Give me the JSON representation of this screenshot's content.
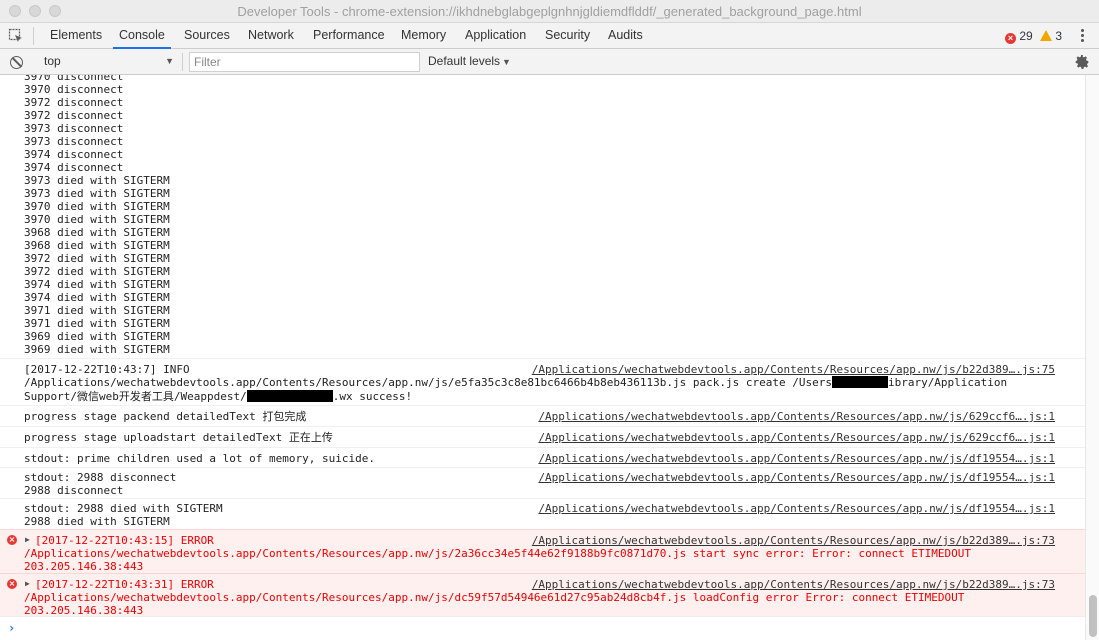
{
  "window": {
    "title": "Developer Tools - chrome-extension://ikhdnebglabgeplgnhnjgldiemdflddf/_generated_background_page.html"
  },
  "tabs": [
    "Elements",
    "Console",
    "Sources",
    "Network",
    "Performance",
    "Memory",
    "Application",
    "Security",
    "Audits"
  ],
  "active_tab": "Console",
  "counts": {
    "errors": "29",
    "warnings": "3"
  },
  "toolbar": {
    "context": "top",
    "filter_placeholder": "Filter",
    "levels": "Default levels"
  },
  "plain_log": "3970 disconnect\n3970 disconnect\n3972 disconnect\n3972 disconnect\n3973 disconnect\n3973 disconnect\n3974 disconnect\n3974 disconnect\n3973 died with SIGTERM\n3973 died with SIGTERM\n3970 died with SIGTERM\n3970 died with SIGTERM\n3968 died with SIGTERM\n3968 died with SIGTERM\n3972 died with SIGTERM\n3972 died with SIGTERM\n3974 died with SIGTERM\n3974 died with SIGTERM\n3971 died with SIGTERM\n3971 died with SIGTERM\n3969 died with SIGTERM\n3969 died with SIGTERM",
  "messages": {
    "info": {
      "line1": "[2017-12-22T10:43:7] INFO",
      "line2a": "/Applications/wechatwebdevtools.app/Contents/Resources/app.nw/js/e5fa35c3c8e81bc6466b4b8eb436113b.js pack.js create /Users",
      "line2b": "ibrary/Application",
      "line3a": "Support/微信web开发者工具/Weappdest/",
      "line3b": ".wx success!",
      "source": "/Applications/wechatwebdevtools.app/Contents/Resources/app.nw/js/b22d389….js:75"
    },
    "packend": {
      "text": "progress stage packend detailedText 打包完成",
      "source": "/Applications/wechatwebdevtools.app/Contents/Resources/app.nw/js/629ccf6….js:1"
    },
    "uploadstart": {
      "text": "progress stage uploadstart detailedText 正在上传",
      "source": "/Applications/wechatwebdevtools.app/Contents/Resources/app.nw/js/629ccf6….js:1"
    },
    "prime": {
      "text": "stdout: prime children used a lot of memory, suicide.",
      "source": "/Applications/wechatwebdevtools.app/Contents/Resources/app.nw/js/df19554….js:1"
    },
    "disconnect": {
      "text": "stdout: 2988 disconnect\n2988 disconnect",
      "source": "/Applications/wechatwebdevtools.app/Contents/Resources/app.nw/js/df19554….js:1"
    },
    "sigterm": {
      "text": "stdout: 2988 died with SIGTERM\n2988 died with SIGTERM",
      "source": "/Applications/wechatwebdevtools.app/Contents/Resources/app.nw/js/df19554….js:1"
    },
    "error1": {
      "line1": "[2017-12-22T10:43:15] ERROR",
      "rest": "/Applications/wechatwebdevtools.app/Contents/Resources/app.nw/js/2a36cc34e5f44e62f9188b9fc0871d70.js start sync error: Error: connect ETIMEDOUT\n203.205.146.38:443",
      "source": "/Applications/wechatwebdevtools.app/Contents/Resources/app.nw/js/b22d389….js:73"
    },
    "error2": {
      "line1": "[2017-12-22T10:43:31] ERROR",
      "rest": "/Applications/wechatwebdevtools.app/Contents/Resources/app.nw/js/dc59f57d54946e61d27c95ab24d8cb4f.js loadConfig error Error: connect ETIMEDOUT\n203.205.146.38:443",
      "source": "/Applications/wechatwebdevtools.app/Contents/Resources/app.nw/js/b22d389….js:73"
    }
  },
  "icons": {
    "inspect": "inspect-element-icon",
    "clear": "clear-console-icon",
    "settings": "gear-icon",
    "more": "kebab-menu-icon"
  },
  "colors": {
    "accent": "#1a73e8",
    "error": "#e53935",
    "warning": "#f2a600",
    "error_bg": "#fff0f0"
  }
}
